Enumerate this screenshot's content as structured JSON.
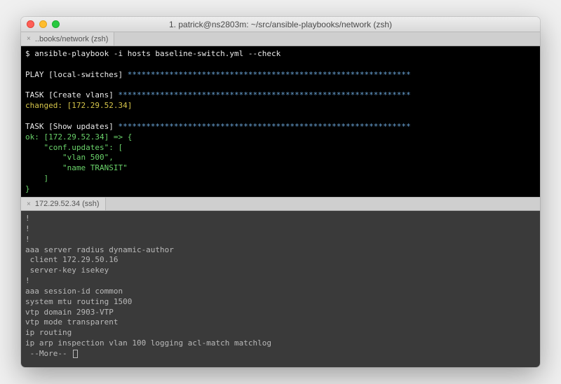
{
  "window": {
    "title": "1. patrick@ns2803m: ~/src/ansible-playbooks/network (zsh)"
  },
  "tabs": {
    "top": {
      "label": "..books/network (zsh)",
      "close": "×"
    },
    "bottom": {
      "label": "172.29.52.34 (ssh)",
      "close": "×"
    }
  },
  "top_pane": {
    "prompt": "$ ",
    "command": "ansible-playbook -i hosts baseline-switch.yml --check",
    "play_label": "PLAY [local-switches] ",
    "play_stars": "*************************************************************",
    "task1_label": "TASK [Create vlans] ",
    "task1_stars": "***************************************************************",
    "changed_prefix": "changed: ",
    "changed_host": "[172.29.52.34]",
    "task2_label": "TASK [Show updates] ",
    "task2_stars": "***************************************************************",
    "ok_prefix": "ok: ",
    "ok_host": "[172.29.52.34]",
    "ok_arrow": " => {",
    "conf_key": "    \"conf.updates\": [",
    "vlan": "        \"vlan 500\",",
    "name_transit": "        \"name TRANSIT\"",
    "close_bracket": "    ]",
    "close_brace": "}"
  },
  "bottom_pane": {
    "lines": [
      "!",
      "!",
      "!",
      "aaa server radius dynamic-author",
      " client 172.29.50.16",
      " server-key isekey",
      "!",
      "aaa session-id common",
      "system mtu routing 1500",
      "vtp domain 2903-VTP",
      "vtp mode transparent",
      "ip routing",
      "ip arp inspection vlan 100 logging acl-match matchlog"
    ],
    "more": " --More-- "
  }
}
